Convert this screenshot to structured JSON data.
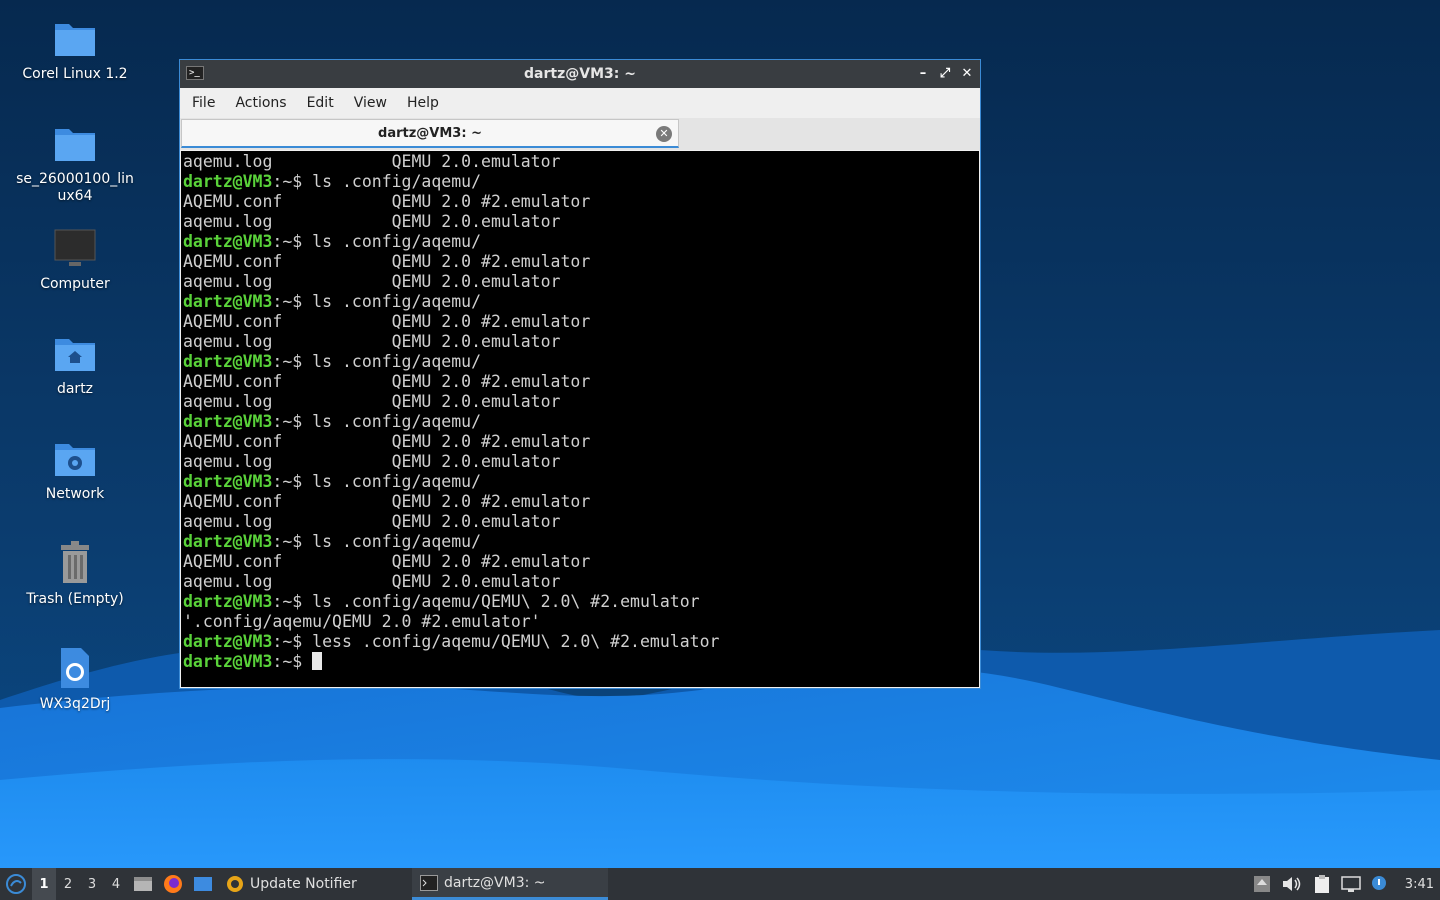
{
  "desktop": {
    "icons": [
      {
        "label": "Corel Linux 1.2",
        "icon": "folder-icon"
      },
      {
        "label": "se_26000100_linux64",
        "icon": "folder-icon"
      },
      {
        "label": "Computer",
        "icon": "computer-icon"
      },
      {
        "label": "dartz",
        "icon": "home-folder-icon"
      },
      {
        "label": "Network",
        "icon": "network-folder-icon"
      },
      {
        "label": "Trash (Empty)",
        "icon": "trash-icon"
      },
      {
        "label": "WX3q2Drj",
        "icon": "web-file-icon"
      }
    ]
  },
  "window": {
    "title": "dartz@VM3: ~",
    "controls": {
      "minimize": "–",
      "maximize": "⤢",
      "close": "✕"
    },
    "menu": [
      "File",
      "Actions",
      "Edit",
      "View",
      "Help"
    ],
    "tab": {
      "label": "dartz@VM3: ~",
      "close": "✕"
    }
  },
  "terminal": {
    "prompt_user": "dartz@VM3",
    "prompt_path": ":~$",
    "lines": [
      {
        "type": "out",
        "text": "aqemu.log            QEMU 2.0.emulator"
      },
      {
        "type": "cmd",
        "text": " ls .config/aqemu/"
      },
      {
        "type": "out",
        "text": "AQEMU.conf           QEMU 2.0 #2.emulator"
      },
      {
        "type": "out",
        "text": "aqemu.log            QEMU 2.0.emulator"
      },
      {
        "type": "cmd",
        "text": " ls .config/aqemu/"
      },
      {
        "type": "out",
        "text": "AQEMU.conf           QEMU 2.0 #2.emulator"
      },
      {
        "type": "out",
        "text": "aqemu.log            QEMU 2.0.emulator"
      },
      {
        "type": "cmd",
        "text": " ls .config/aqemu/"
      },
      {
        "type": "out",
        "text": "AQEMU.conf           QEMU 2.0 #2.emulator"
      },
      {
        "type": "out",
        "text": "aqemu.log            QEMU 2.0.emulator"
      },
      {
        "type": "cmd",
        "text": " ls .config/aqemu/"
      },
      {
        "type": "out",
        "text": "AQEMU.conf           QEMU 2.0 #2.emulator"
      },
      {
        "type": "out",
        "text": "aqemu.log            QEMU 2.0.emulator"
      },
      {
        "type": "cmd",
        "text": " ls .config/aqemu/"
      },
      {
        "type": "out",
        "text": "AQEMU.conf           QEMU 2.0 #2.emulator"
      },
      {
        "type": "out",
        "text": "aqemu.log            QEMU 2.0.emulator"
      },
      {
        "type": "cmd",
        "text": " ls .config/aqemu/"
      },
      {
        "type": "out",
        "text": "AQEMU.conf           QEMU 2.0 #2.emulator"
      },
      {
        "type": "out",
        "text": "aqemu.log            QEMU 2.0.emulator"
      },
      {
        "type": "cmd",
        "text": " ls .config/aqemu/"
      },
      {
        "type": "out",
        "text": "AQEMU.conf           QEMU 2.0 #2.emulator"
      },
      {
        "type": "out",
        "text": "aqemu.log            QEMU 2.0.emulator"
      },
      {
        "type": "cmd",
        "text": " ls .config/aqemu/QEMU\\ 2.0\\ #2.emulator"
      },
      {
        "type": "out",
        "text": "'.config/aqemu/QEMU 2.0 #2.emulator'"
      },
      {
        "type": "cmd",
        "text": " less .config/aqemu/QEMU\\ 2.0\\ #2.emulator"
      },
      {
        "type": "cmd",
        "text": " ",
        "cursor": true
      }
    ]
  },
  "taskbar": {
    "start_icon": "lubuntu-start-icon",
    "workspaces": [
      "1",
      "2",
      "3",
      "4"
    ],
    "active_workspace": "1",
    "launchers": [
      "file-manager-icon",
      "firefox-icon",
      "show-desktop-icon"
    ],
    "tasks": [
      {
        "label": "Update Notifier",
        "icon": "update-notifier-icon",
        "active": false
      },
      {
        "label": "dartz@VM3: ~",
        "icon": "terminal-icon",
        "active": true
      }
    ],
    "tray": [
      "eject-icon",
      "volume-icon",
      "clipboard-icon",
      "network-status-icon",
      "notification-icon"
    ],
    "clock": "3:41"
  }
}
